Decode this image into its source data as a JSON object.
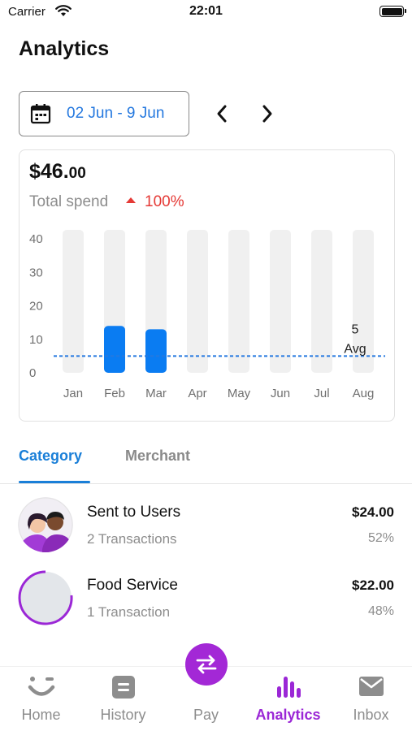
{
  "status_bar": {
    "carrier": "Carrier",
    "time": "22:01"
  },
  "header": {
    "title": "Analytics"
  },
  "date_range": {
    "label": "02 Jun - 9 Jun"
  },
  "summary": {
    "amount_main": "$46.",
    "amount_cents": "00",
    "label": "Total spend",
    "trend": "100%"
  },
  "chart_data": {
    "type": "bar",
    "categories": [
      "Jan",
      "Feb",
      "Mar",
      "Apr",
      "May",
      "Jun",
      "Jul",
      "Aug"
    ],
    "values": [
      0,
      14,
      13,
      0,
      0,
      0,
      0,
      0
    ],
    "yticks": [
      0,
      10,
      20,
      30,
      40
    ],
    "ylim": [
      0,
      40
    ],
    "avg_value": 5,
    "avg_label_value": "5",
    "avg_label_text": "Avg",
    "bar_color": "#0a7cf2",
    "track_color": "#f0f0f0",
    "avg_line_color": "#2478df"
  },
  "tabs": {
    "category": "Category",
    "merchant": "Merchant"
  },
  "list": [
    {
      "title": "Sent to Users",
      "subtitle": "2 Transactions",
      "amount": "$24.00",
      "percent": "52%"
    },
    {
      "title": "Food Service",
      "subtitle": "1 Transaction",
      "amount": "$22.00",
      "percent": "48%"
    }
  ],
  "bottom_nav": {
    "home": "Home",
    "history": "History",
    "pay": "Pay",
    "analytics": "Analytics",
    "inbox": "Inbox"
  },
  "colors": {
    "accent_blue": "#1a7fd8",
    "accent_purple": "#9b27d6",
    "trend_red": "#e53935"
  }
}
